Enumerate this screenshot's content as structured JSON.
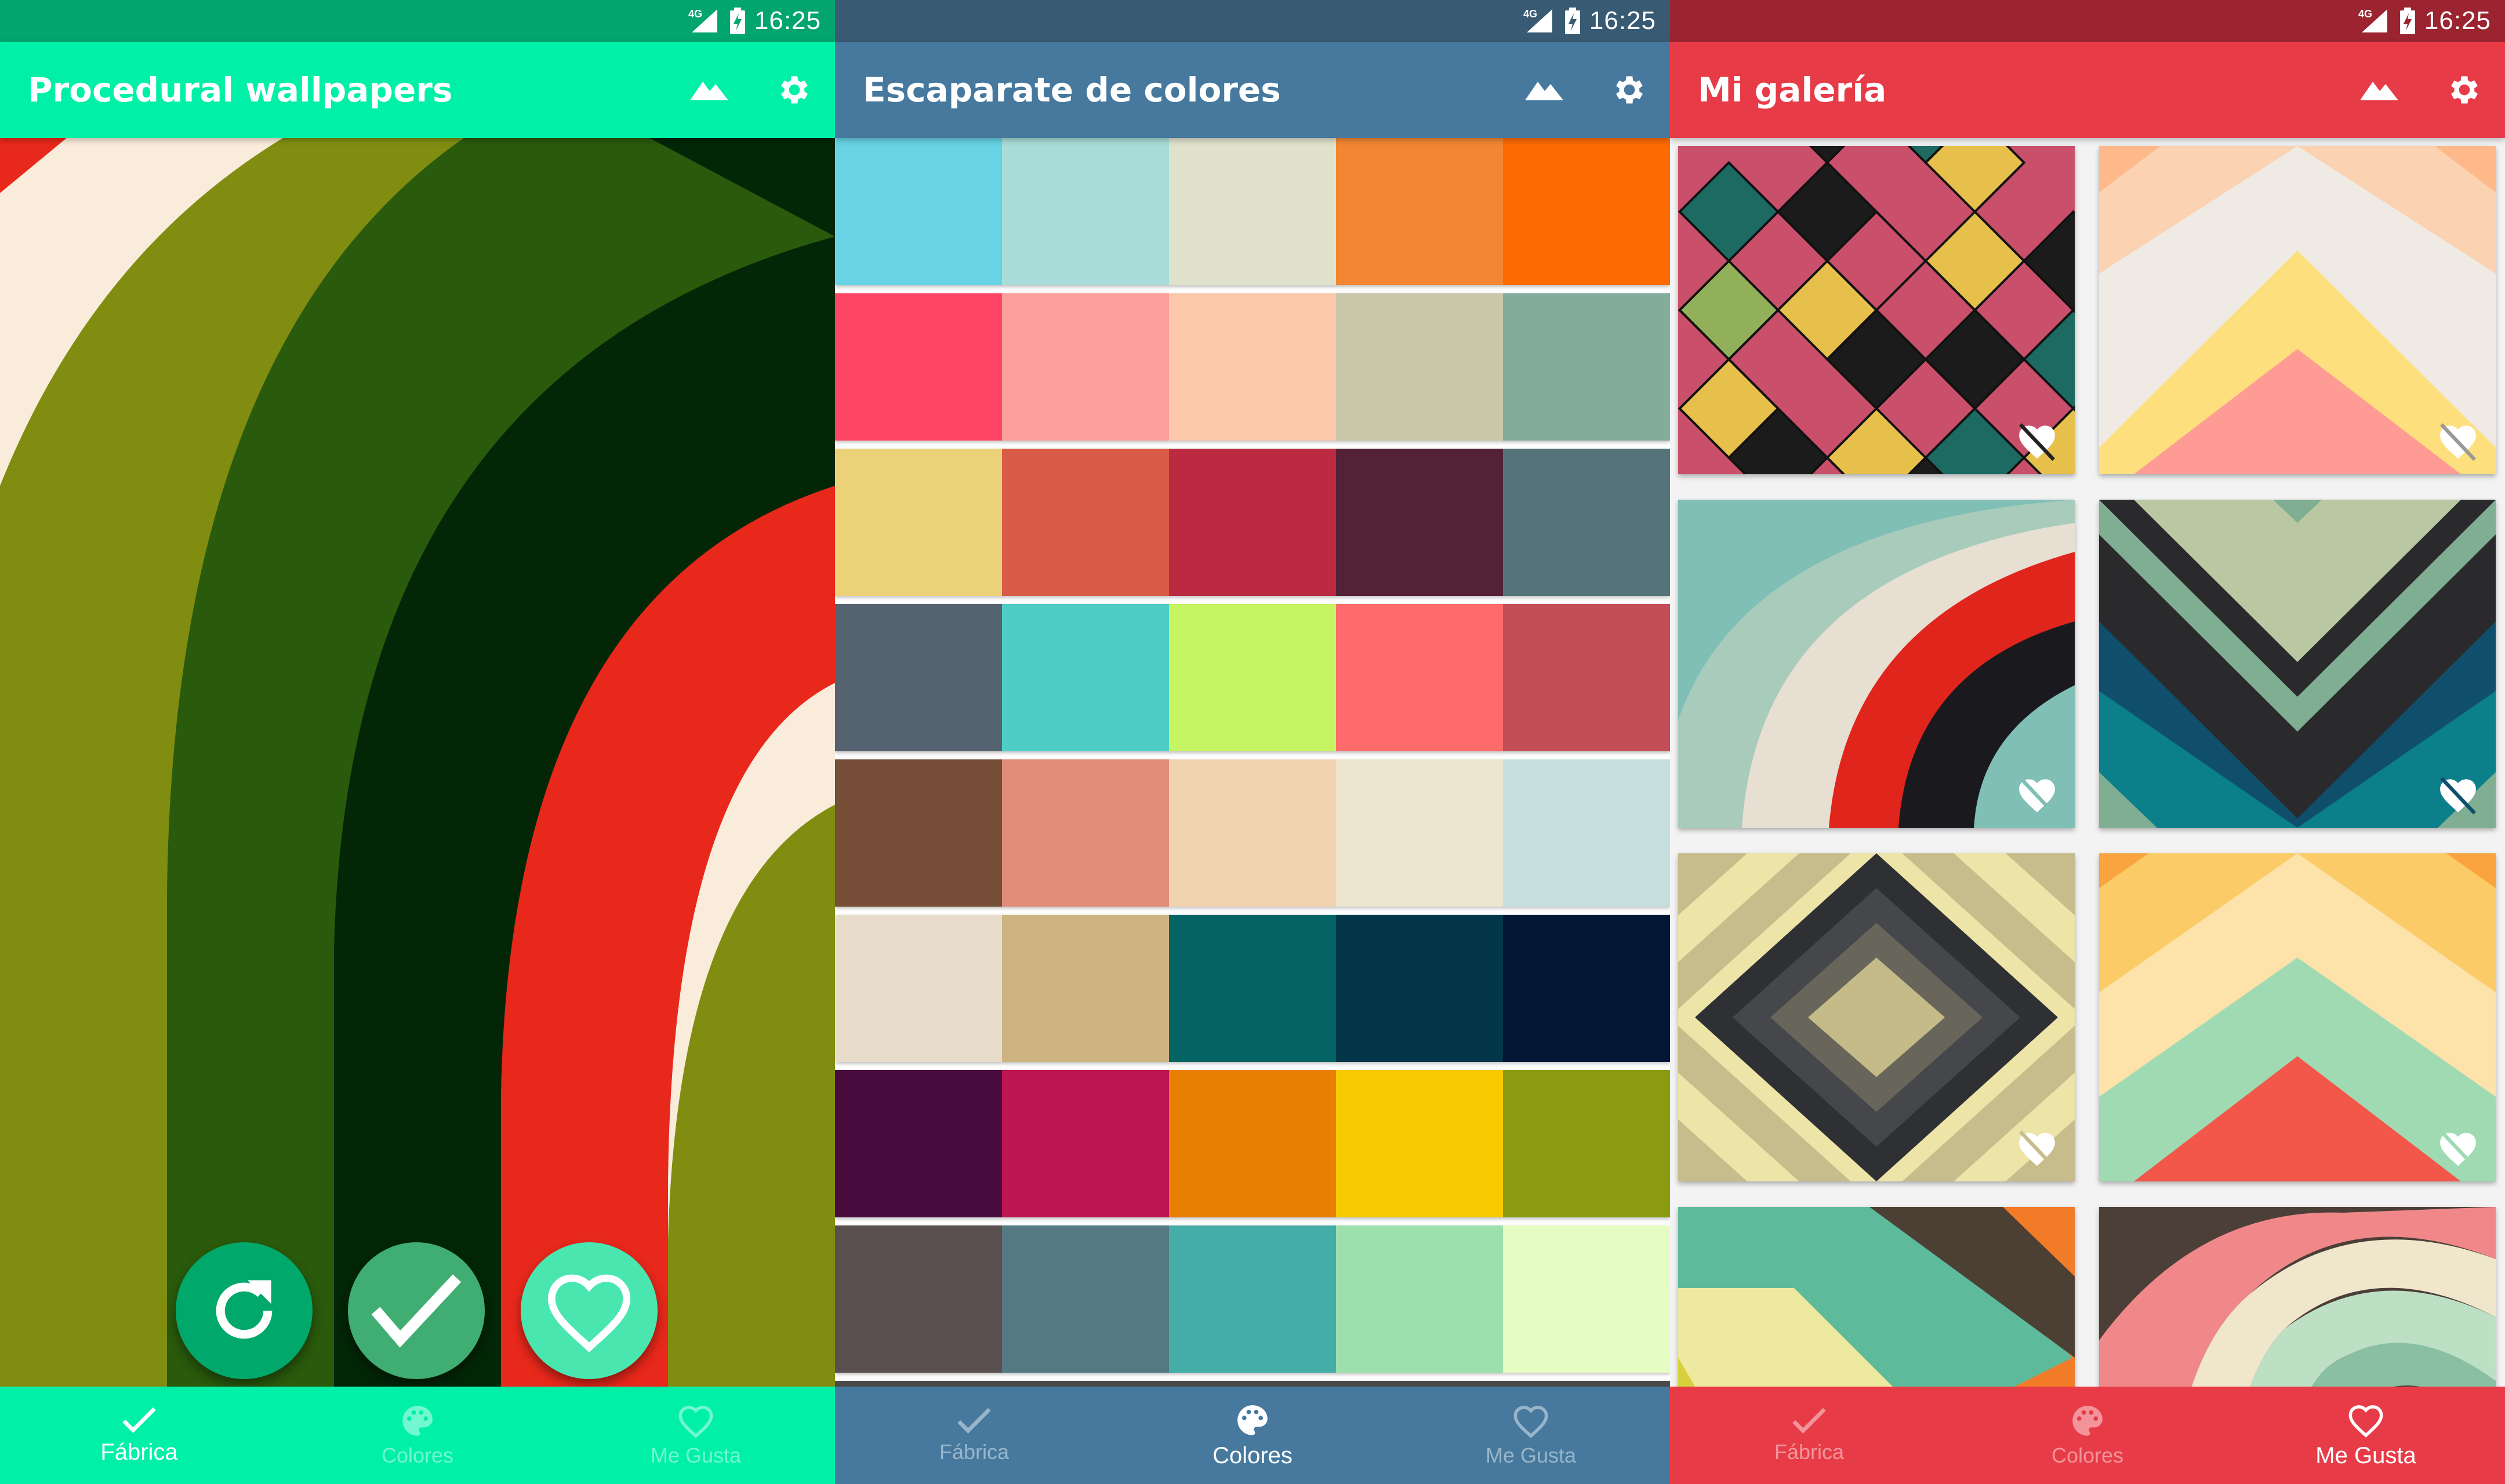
{
  "status_bar": {
    "time": "16:25",
    "network": "4G"
  },
  "screens": [
    {
      "title": "Procedural wallpapers",
      "colors": {
        "status": "#02a56e",
        "bar": "#00f0a8",
        "nav": "#00f0a8"
      },
      "actions": {
        "refresh": "refresh-icon",
        "apply": "check-icon",
        "like": "heart-icon"
      },
      "fab_colors": [
        "#00a86b",
        "#40ad72",
        "#49e6b0"
      ],
      "wallpaper_colors": [
        "#e8281b",
        "#f9ecdb",
        "#808d11",
        "#2a5a0c",
        "#032607"
      ]
    },
    {
      "title": "Escaparate de colores",
      "colors": {
        "status": "#385a72",
        "bar": "#46799d",
        "nav": "#46799d"
      },
      "palettes": [
        [
          "#67d3e5",
          "#a8dcd8",
          "#e0e2cc",
          "#f28632",
          "#fe6a02"
        ],
        [
          "#ff4565",
          "#fe9e9a",
          "#fbc8aa",
          "#cac6aa",
          "#82ad9b"
        ],
        [
          "#ebd177",
          "#d95c46",
          "#bc2a42",
          "#542237",
          "#557479"
        ],
        [
          "#556270",
          "#4ecdc4",
          "#c5f562",
          "#ff6b6b",
          "#c44e58"
        ],
        [
          "#774e38",
          "#e08d7a",
          "#f1d3b1",
          "#ebe5d0",
          "#c6dfdd"
        ],
        [
          "#e8ddcb",
          "#cdb381",
          "#036463",
          "#033649",
          "#031634"
        ],
        [
          "#490a3d",
          "#bd1550",
          "#e97f02",
          "#f8ca00",
          "#8a9b0f"
        ],
        [
          "#594f4f",
          "#547980",
          "#45ada8",
          "#9de0ad",
          "#e5fcc2"
        ]
      ]
    },
    {
      "title": "Mi galería",
      "colors": {
        "status": "#9b2430",
        "bar": "#e73c48",
        "nav": "#e73c48"
      },
      "unlike_icon": "heart-broken-icon"
    }
  ],
  "nav": [
    {
      "label": "Fábrica",
      "icon": "check-icon"
    },
    {
      "label": "Colores",
      "icon": "palette-icon"
    },
    {
      "label": "Me Gusta",
      "icon": "heart-outline-icon"
    }
  ],
  "active_tab": [
    "Fábrica",
    "Colores",
    "Me Gusta"
  ]
}
